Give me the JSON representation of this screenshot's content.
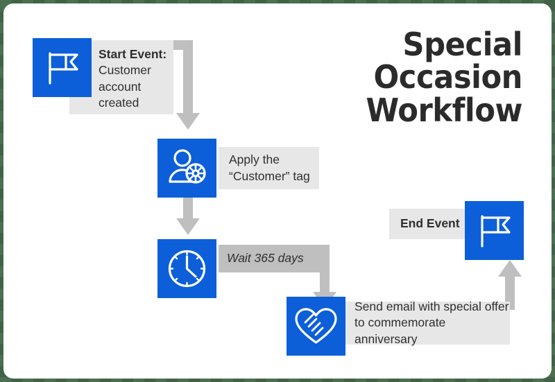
{
  "title": {
    "line1": "Special Occasion",
    "line2": "Workflow"
  },
  "colors": {
    "tile_blue": "#0c5fd8",
    "label_light_gray": "#e7e7e7",
    "label_dark_gray": "#bfbfbf",
    "arrow_gray": "#bfbfbf",
    "text_dark": "#2f2f2f",
    "title_dark": "#2b2b2b",
    "canvas_white": "#ffffff"
  },
  "steps": [
    {
      "id": "start-event",
      "icon": "flag-icon",
      "label_bold": "Start Event:",
      "label_text": "Customer account created"
    },
    {
      "id": "apply-tag",
      "icon": "user-gear-icon",
      "label_text": "Apply the “Customer” tag"
    },
    {
      "id": "wait",
      "icon": "clock-icon",
      "label_text": "Wait 365 days"
    },
    {
      "id": "send-email",
      "icon": "heart-handshake-icon",
      "label_line1": "Send email with special offer",
      "label_line2": "to commemorate anniversary"
    },
    {
      "id": "end-event",
      "icon": "flag-icon",
      "label_text": "End Event"
    }
  ],
  "connectors": [
    {
      "id": "start-to-tag",
      "direction": "down"
    },
    {
      "id": "tag-to-wait",
      "direction": "down"
    },
    {
      "id": "wait-to-email",
      "direction": "down"
    },
    {
      "id": "email-to-end",
      "direction": "up"
    }
  ]
}
